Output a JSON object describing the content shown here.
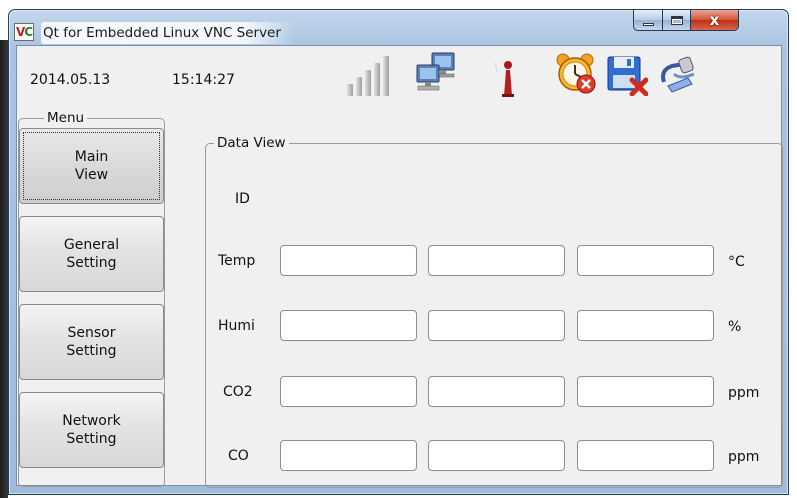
{
  "window": {
    "title": "Qt for Embedded Linux VNC Server",
    "icon_text_v": "V",
    "icon_text_c": "C",
    "controls": [
      "minimize-icon",
      "maximize-icon",
      "close-icon"
    ],
    "close_glyph": "x"
  },
  "header": {
    "date": "2014.05.13",
    "time": "15:14:27",
    "status_icons": [
      "signal-strength-icon",
      "network-computers-icon",
      "antenna-icon",
      "alarm-clock-disabled-icon",
      "save-error-icon",
      "plug-connection-icon"
    ]
  },
  "menu": {
    "title": "Menu",
    "items": [
      {
        "label": "Main\nView",
        "active": true
      },
      {
        "label": "General\nSetting",
        "active": false
      },
      {
        "label": "Sensor\nSetting",
        "active": false
      },
      {
        "label": "Network\nSetting",
        "active": false
      }
    ]
  },
  "data_view": {
    "title": "Data View",
    "id_label": "ID",
    "rows": [
      {
        "label": "Temp",
        "unit": "°C",
        "values": [
          "",
          "",
          ""
        ]
      },
      {
        "label": "Humi",
        "unit": "%",
        "values": [
          "",
          "",
          ""
        ]
      },
      {
        "label": "CO2",
        "unit": "ppm",
        "values": [
          "",
          "",
          ""
        ]
      },
      {
        "label": "CO",
        "unit": "ppm",
        "values": [
          "",
          "",
          ""
        ]
      }
    ]
  },
  "colors": {
    "frame": "#9fbcdc",
    "close_button": "#c8391d",
    "client_background": "#f0f0f0"
  }
}
